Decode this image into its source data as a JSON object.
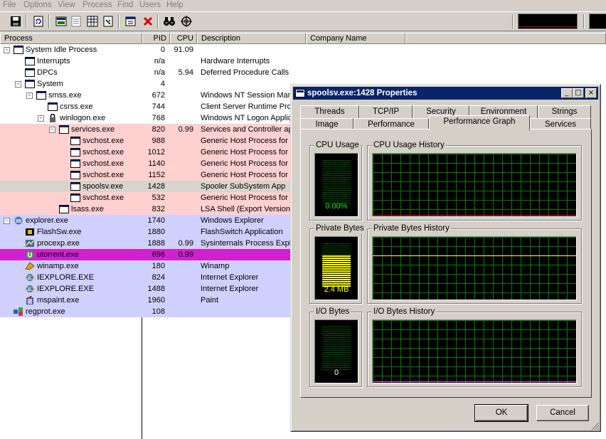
{
  "menu": [
    "File",
    "Options",
    "View",
    "Process",
    "Find",
    "Users",
    "Help"
  ],
  "columns": {
    "process": "Process",
    "pid": "PID",
    "cpu": "CPU",
    "description": "Description",
    "company": "Company Name"
  },
  "processes": [
    {
      "name": "System Idle Process",
      "pid": "0",
      "cpu": "91.09",
      "desc": "",
      "indent": 0,
      "toggle": "-",
      "icon": "window",
      "color": "#ffffff"
    },
    {
      "name": "Interrupts",
      "pid": "n/a",
      "cpu": "",
      "desc": "Hardware Interrupts",
      "indent": 1,
      "toggle": "",
      "icon": "window",
      "color": "#ffffff"
    },
    {
      "name": "DPCs",
      "pid": "n/a",
      "cpu": "5.94",
      "desc": "Deferred Procedure Calls",
      "indent": 1,
      "toggle": "",
      "icon": "window",
      "color": "#ffffff"
    },
    {
      "name": "System",
      "pid": "4",
      "cpu": "",
      "desc": "",
      "indent": 1,
      "toggle": "-",
      "icon": "window",
      "color": "#ffffff"
    },
    {
      "name": "smss.exe",
      "pid": "672",
      "cpu": "",
      "desc": "Windows NT Session Manager",
      "indent": 2,
      "toggle": "-",
      "icon": "window",
      "color": "#ffffff"
    },
    {
      "name": "csrss.exe",
      "pid": "744",
      "cpu": "",
      "desc": "Client Server Runtime Process",
      "indent": 3,
      "toggle": "",
      "icon": "window",
      "color": "#ffffff"
    },
    {
      "name": "winlogon.exe",
      "pid": "768",
      "cpu": "",
      "desc": "Windows NT Logon Application",
      "indent": 3,
      "toggle": "-",
      "icon": "winlogon",
      "color": "#ffffff"
    },
    {
      "name": "services.exe",
      "pid": "820",
      "cpu": "0.99",
      "desc": "Services and Controller app",
      "indent": 4,
      "toggle": "-",
      "icon": "window",
      "color": "#ffd0d0"
    },
    {
      "name": "svchost.exe",
      "pid": "988",
      "cpu": "",
      "desc": "Generic Host Process for Win32 Services",
      "indent": 5,
      "toggle": "",
      "icon": "window",
      "color": "#ffd0d0"
    },
    {
      "name": "svchost.exe",
      "pid": "1012",
      "cpu": "",
      "desc": "Generic Host Process for Win32 Services",
      "indent": 5,
      "toggle": "",
      "icon": "window",
      "color": "#ffd0d0"
    },
    {
      "name": "svchost.exe",
      "pid": "1140",
      "cpu": "",
      "desc": "Generic Host Process for Win32 Services",
      "indent": 5,
      "toggle": "",
      "icon": "window",
      "color": "#ffd0d0"
    },
    {
      "name": "svchost.exe",
      "pid": "1152",
      "cpu": "",
      "desc": "Generic Host Process for Win32 Services",
      "indent": 5,
      "toggle": "",
      "icon": "window",
      "color": "#ffd0d0"
    },
    {
      "name": "spoolsv.exe",
      "pid": "1428",
      "cpu": "",
      "desc": "Spooler SubSystem App",
      "indent": 5,
      "toggle": "",
      "icon": "window",
      "color": "#d8d4cc"
    },
    {
      "name": "svchost.exe",
      "pid": "532",
      "cpu": "",
      "desc": "Generic Host Process for Win32 Services",
      "indent": 5,
      "toggle": "",
      "icon": "window",
      "color": "#ffd0d0"
    },
    {
      "name": "lsass.exe",
      "pid": "832",
      "cpu": "",
      "desc": "LSA Shell (Export Version)",
      "indent": 4,
      "toggle": "",
      "icon": "window",
      "color": "#ffd0d0"
    },
    {
      "name": "explorer.exe",
      "pid": "1740",
      "cpu": "",
      "desc": "Windows Explorer",
      "indent": 0,
      "toggle": "-",
      "icon": "explorer",
      "color": "#d0d0ff"
    },
    {
      "name": "FlashSw.exe",
      "pid": "1880",
      "cpu": "",
      "desc": "FlashSwitch Application",
      "indent": 1,
      "toggle": "",
      "icon": "flash",
      "color": "#d0d0ff"
    },
    {
      "name": "procexp.exe",
      "pid": "1888",
      "cpu": "0.99",
      "desc": "Sysinternals Process Explorer",
      "indent": 1,
      "toggle": "",
      "icon": "procexp",
      "color": "#d0d0ff"
    },
    {
      "name": "utorrent.exe",
      "pid": "696",
      "cpu": "0.99",
      "desc": "",
      "indent": 1,
      "toggle": "",
      "icon": "utorrent",
      "color": "#d020d0"
    },
    {
      "name": "winamp.exe",
      "pid": "180",
      "cpu": "",
      "desc": "Winamp",
      "indent": 1,
      "toggle": "",
      "icon": "winamp",
      "color": "#d0d0ff"
    },
    {
      "name": "IEXPLORE.EXE",
      "pid": "824",
      "cpu": "",
      "desc": "Internet Explorer",
      "indent": 1,
      "toggle": "",
      "icon": "ie",
      "color": "#d0d0ff"
    },
    {
      "name": "IEXPLORE.EXE",
      "pid": "1488",
      "cpu": "",
      "desc": "Internet Explorer",
      "indent": 1,
      "toggle": "",
      "icon": "ie",
      "color": "#d0d0ff"
    },
    {
      "name": "mspaint.exe",
      "pid": "1960",
      "cpu": "",
      "desc": "Paint",
      "indent": 1,
      "toggle": "",
      "icon": "paint",
      "color": "#d0d0ff"
    },
    {
      "name": "regprot.exe",
      "pid": "108",
      "cpu": "",
      "desc": "",
      "indent": 0,
      "toggle": "",
      "icon": "regprot",
      "color": "#d0d0ff"
    }
  ],
  "dialog": {
    "title": "spoolsv.exe:1428 Properties",
    "tabs_top": [
      "Threads",
      "TCP/IP",
      "Security",
      "Environment",
      "Strings"
    ],
    "tabs_bottom": [
      "Image",
      "Performance",
      "Performance Graph",
      "Services"
    ],
    "active_tab": "Performance Graph",
    "groups": {
      "cpu_usage": {
        "label": "CPU Usage",
        "value": "0.00%",
        "level": 0
      },
      "cpu_history": {
        "label": "CPU Usage History"
      },
      "private_bytes": {
        "label": "Private Bytes",
        "value": "2.4 MB",
        "level": 0.72
      },
      "private_history": {
        "label": "Private Bytes History"
      },
      "io_bytes": {
        "label": "I/O Bytes",
        "value": "0",
        "level": 0
      },
      "io_history": {
        "label": "I/O Bytes History"
      }
    },
    "ok_label": "OK",
    "cancel_label": "Cancel"
  },
  "colors": {
    "services": "#ffd0d0",
    "own_process": "#d0d0ff",
    "new_process": "#d020d0",
    "selected": "#d8d4cc",
    "titlebar": "#0a246a"
  }
}
